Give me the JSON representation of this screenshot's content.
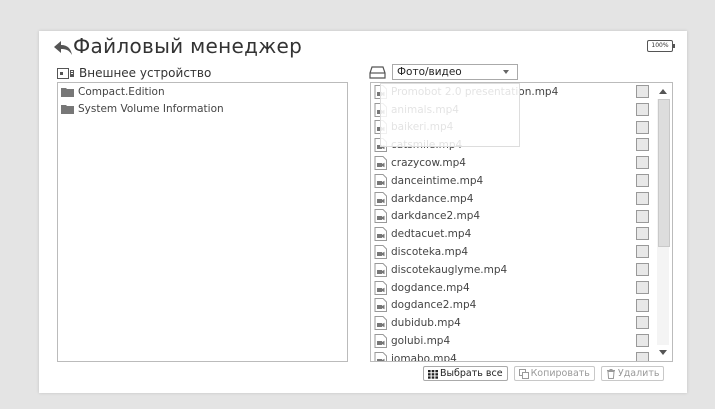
{
  "header": {
    "title": "Файловый менеджер",
    "battery": "100%"
  },
  "left": {
    "device_label": "Внешнее устройство",
    "folders": [
      "Compact.Edition",
      "System Volume Information"
    ]
  },
  "right": {
    "filter_selected": "Фото/видео",
    "files": [
      "Promobot 2.0 presentation.mp4",
      "animals.mp4",
      "baikeri.mp4",
      "catsmile.mp4",
      "crazycow.mp4",
      "danceintime.mp4",
      "darkdance.mp4",
      "darkdance2.mp4",
      "dedtacuet.mp4",
      "discoteka.mp4",
      "discotekauglyme.mp4",
      "dogdance.mp4",
      "dogdance2.mp4",
      "dubidub.mp4",
      "golubi.mp4",
      "jomabo.mp4"
    ]
  },
  "actions": {
    "select_all": "Выбрать все",
    "copy": "Копировать",
    "delete": "Удалить"
  },
  "colors": {
    "background": "#e4e4e4",
    "panel": "#ffffff",
    "checkbox": "#e8e8e8"
  }
}
